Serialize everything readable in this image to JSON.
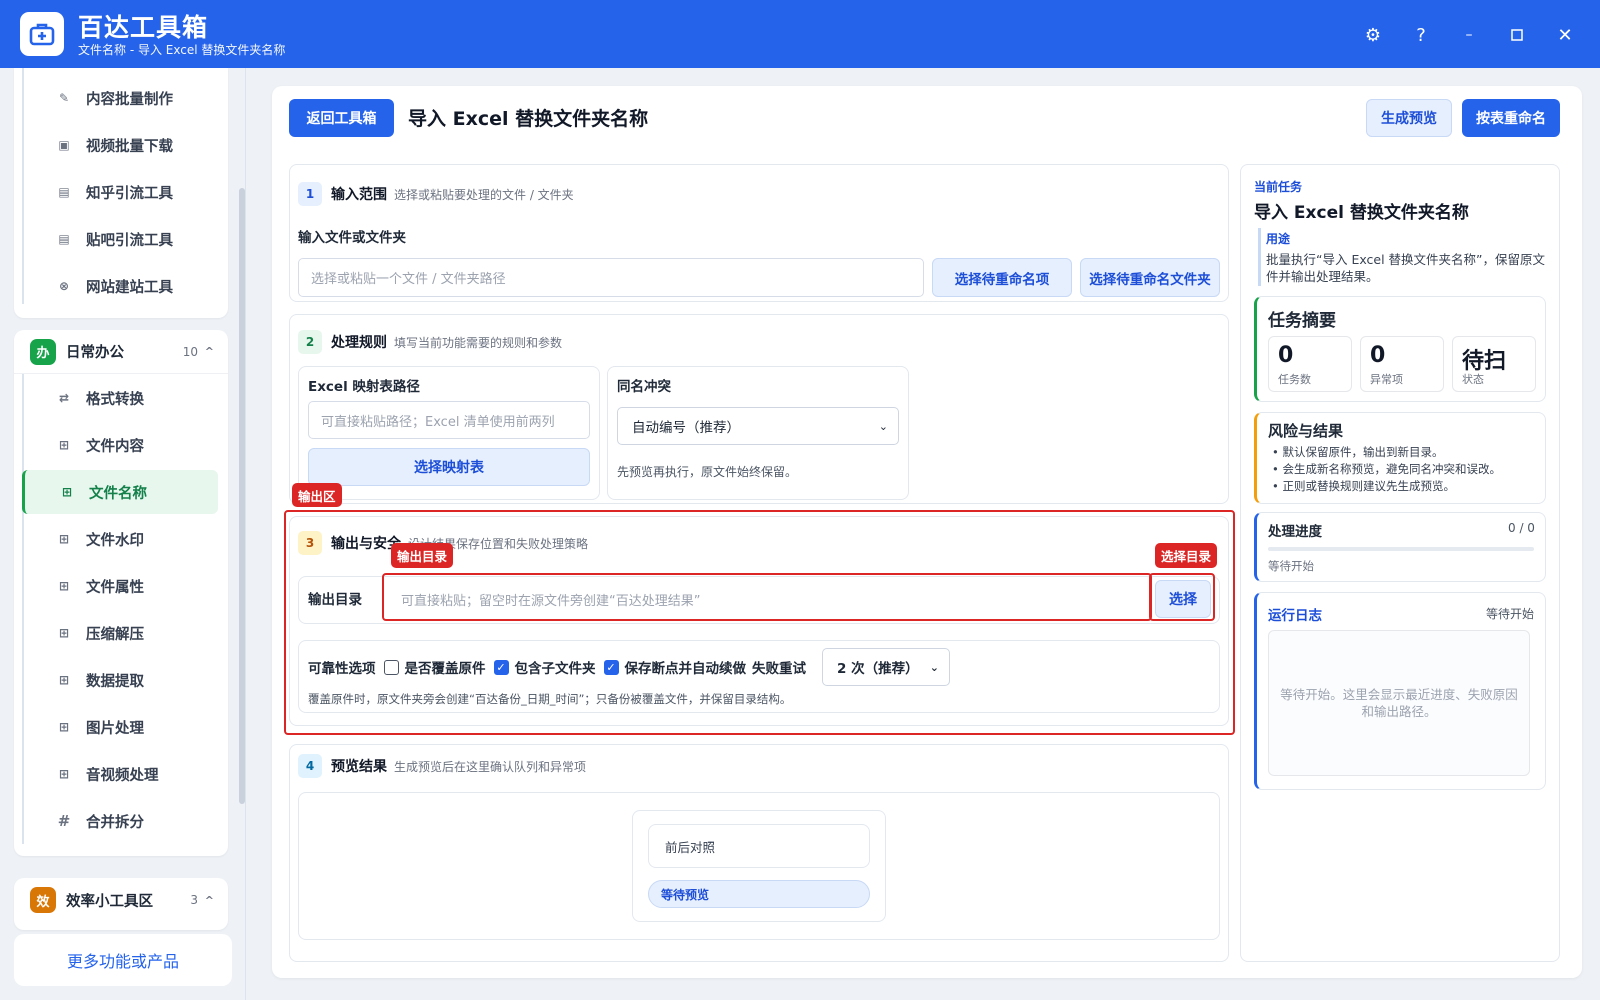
{
  "app": {
    "title": "百达工具箱",
    "subtitle": "文件名称 - 导入 Excel 替换文件夹名称"
  },
  "sidebar": {
    "group1_items": [
      {
        "label": "内容批量制作",
        "icon": "pencil-icon"
      },
      {
        "label": "视频批量下载",
        "icon": "video-icon"
      },
      {
        "label": "知乎引流工具",
        "icon": "zhihu-icon"
      },
      {
        "label": "贴吧引流工具",
        "icon": "doc-icon"
      },
      {
        "label": "网站建站工具",
        "icon": "globe-icon"
      }
    ],
    "group2": {
      "badge": "办",
      "title": "日常办公",
      "count": "10",
      "color": "#16a34a"
    },
    "group2_items": [
      {
        "label": "格式转换",
        "icon": "convert-icon"
      },
      {
        "label": "文件内容",
        "icon": "grid-icon"
      },
      {
        "label": "文件名称",
        "icon": "grid-icon"
      },
      {
        "label": "文件水印",
        "icon": "grid-icon"
      },
      {
        "label": "文件属性",
        "icon": "grid-icon"
      },
      {
        "label": "压缩解压",
        "icon": "grid-icon"
      },
      {
        "label": "数据提取",
        "icon": "grid-icon"
      },
      {
        "label": "图片处理",
        "icon": "grid-icon"
      },
      {
        "label": "音视频处理",
        "icon": "grid-icon"
      },
      {
        "label": "合并拆分",
        "icon": "hash-icon"
      }
    ],
    "group3": {
      "badge": "效",
      "title": "效率小工具区",
      "count": "3",
      "color": "#d97706"
    },
    "more": "更多功能或产品"
  },
  "header": {
    "back": "返回工具箱",
    "title": "导入 Excel 替换文件夹名称",
    "preview": "生成预览",
    "rename": "按表重命名"
  },
  "step1": {
    "num": "1",
    "title": "输入范围",
    "desc": "选择或粘贴要处理的文件 / 文件夹",
    "label": "输入文件或文件夹",
    "placeholder": "选择或粘贴一个文件 / 文件夹路径",
    "btn1": "选择待重命名项",
    "btn2": "选择待重命名文件夹"
  },
  "step2": {
    "num": "2",
    "title": "处理规则",
    "desc": "填写当前功能需要的规则和参数",
    "excel_label": "Excel 映射表路径",
    "excel_placeholder": "可直接粘贴路径；Excel 清单使用前两列",
    "excel_btn": "选择映射表",
    "conflict_label": "同名冲突",
    "conflict_value": "自动编号（推荐）",
    "conflict_hint": "先预览再执行，原文件始终保留。"
  },
  "step3": {
    "num": "3",
    "title": "输出与安全",
    "desc": "设计结果保存位置和失败处理策略",
    "out_label": "输出目录",
    "out_placeholder": "可直接粘贴；留空时在源文件旁创建“百达处理结果”",
    "choose": "选择",
    "rel_label": "可靠性选项",
    "opt1": "是否覆盖原件",
    "opt2": "包含子文件夹",
    "opt3": "保存断点并自动续做",
    "retry_label": "失败重试",
    "retry_value": "2 次（推荐）",
    "note": "覆盖原件时，原文件夹旁会创建“百达备份_日期_时间”；只备份被覆盖文件，并保留目录结构。"
  },
  "annotations": {
    "output_area": "输出区",
    "output_dir": "输出目录",
    "choose_dir": "选择目录"
  },
  "step4": {
    "num": "4",
    "title": "预览结果",
    "desc": "生成预览后在这里确认队列和异常项",
    "compare": "前后对照",
    "waiting": "等待预览"
  },
  "side": {
    "task_label": "当前任务",
    "task_title": "导入 Excel 替换文件夹名称",
    "purpose_label": "用途",
    "purpose_text": "批量执行“导入 Excel 替换文件夹名称”，保留原文件并输出处理结果。",
    "summary_title": "任务摘要",
    "stats": [
      {
        "v": "0",
        "k": "任务数"
      },
      {
        "v": "0",
        "k": "异常项"
      },
      {
        "v": "待扫",
        "k": "状态"
      }
    ],
    "risk_title": "风险与结果",
    "risks": [
      "默认保留原件，输出到新目录。",
      "会生成新名称预览，避免同名冲突和误改。",
      "正则或替换规则建议先生成预览。"
    ],
    "progress_title": "处理进度",
    "progress_count": "0 / 0",
    "progress_status": "等待开始",
    "progress": 0,
    "log_title": "运行日志",
    "log_status": "等待开始",
    "log_text": "等待开始。这里会显示最近进度、失败原因和输出路径。"
  }
}
